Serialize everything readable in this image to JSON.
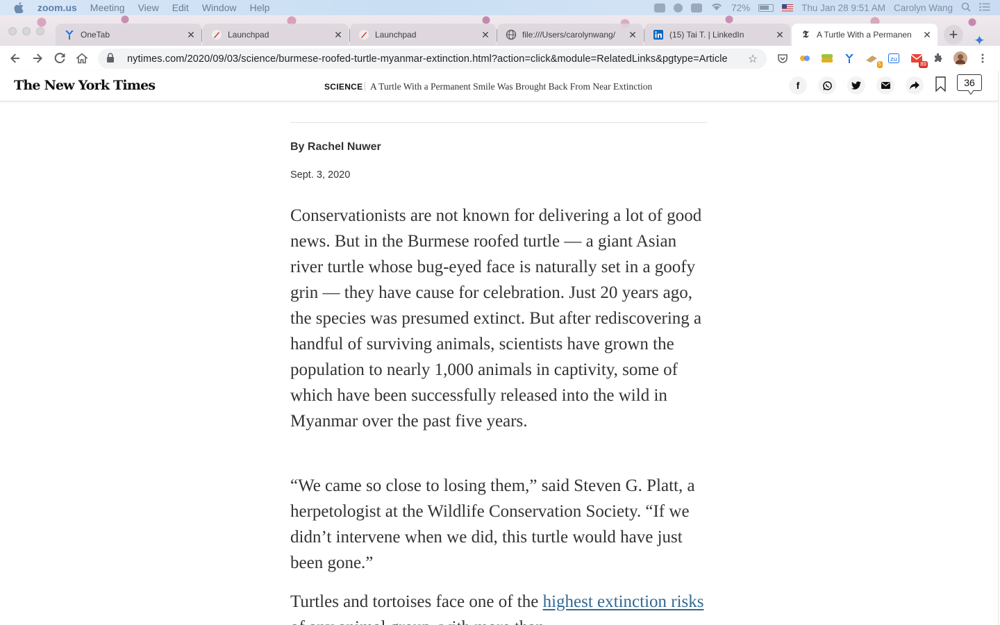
{
  "menubar": {
    "app_name": "zoom.us",
    "items": [
      "Meeting",
      "View",
      "Edit",
      "Window",
      "Help"
    ],
    "battery": "72%",
    "clock": "Thu Jan 28  9:51 AM",
    "user": "Carolyn Wang"
  },
  "tabs": [
    {
      "title": "OneTab",
      "icon": "onetab-icon"
    },
    {
      "title": "Launchpad",
      "icon": "launchpad-icon"
    },
    {
      "title": "Launchpad",
      "icon": "launchpad-icon"
    },
    {
      "title": "file:///Users/carolynwang/",
      "icon": "globe-icon"
    },
    {
      "title": "(15) Tai T. | LinkedIn",
      "icon": "linkedin-icon"
    },
    {
      "title": "A Turtle With a Permanen",
      "icon": "nyt-icon"
    }
  ],
  "address_bar": {
    "url": "nytimes.com/2020/09/03/science/burmese-roofed-turtle-myanmar-extinction.html?action=click&module=RelatedLinks&pgtype=Article"
  },
  "extensions": {
    "badge_orange": "5",
    "badge_gmail": "89"
  },
  "nyt": {
    "logo": "The New York Times",
    "section": "SCIENCE",
    "headline": "A Turtle With a Permanent Smile Was Brought Back From Near Extinction",
    "comment_count": "36"
  },
  "article": {
    "byline": "By Rachel Nuwer",
    "date": "Sept. 3, 2020",
    "paragraph1": "Conservationists are not known for delivering a lot of good news. But in the Burmese roofed turtle — a giant Asian river turtle whose bug-eyed face is naturally set in a goofy grin — they have cause for celebration. Just 20 years ago, the species was presumed extinct. But after rediscovering a handful of surviving animals, scientists have grown the population to nearly 1,000 animals in captivity, some of which have been successfully released into the wild in Myanmar over the past five years.",
    "paragraph2": "“We came so close to losing them,” said Steven G. Platt, a herpetologist at the Wildlife Conservation Society. “If we didn’t intervene when we did, this turtle would have just been gone.”",
    "paragraph3_start": "Turtles and tortoises face one of the ",
    "paragraph3_link": "highest extinction risks",
    "paragraph3_end": " of any animal group, with more than"
  }
}
